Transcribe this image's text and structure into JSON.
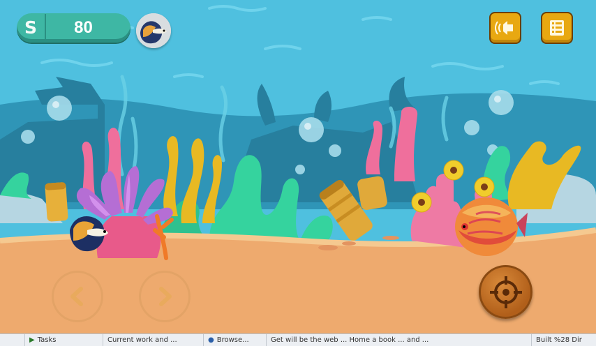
{
  "hud": {
    "currency_symbol": "S",
    "money": "80",
    "avatar_icon": "betta-fish-icon",
    "sound_icon": "speaker-icon",
    "menu_icon": "list-menu-icon",
    "left_icon": "chevron-left-icon",
    "right_icon": "chevron-right-icon",
    "shoot_icon": "crosshair-icon"
  },
  "taskbar": {
    "items": [
      "Tasks",
      "Current work and ...",
      "Browse...",
      "Get will be the web ... Home a book ... and ...",
      "Built %28 Dir"
    ]
  },
  "colors": {
    "water": "#4fc0df",
    "sand": "#eeaa6e",
    "money_pill": "#3eb7a4",
    "button_gold": "#e8a811",
    "shoot_button": "#b15f1a"
  }
}
